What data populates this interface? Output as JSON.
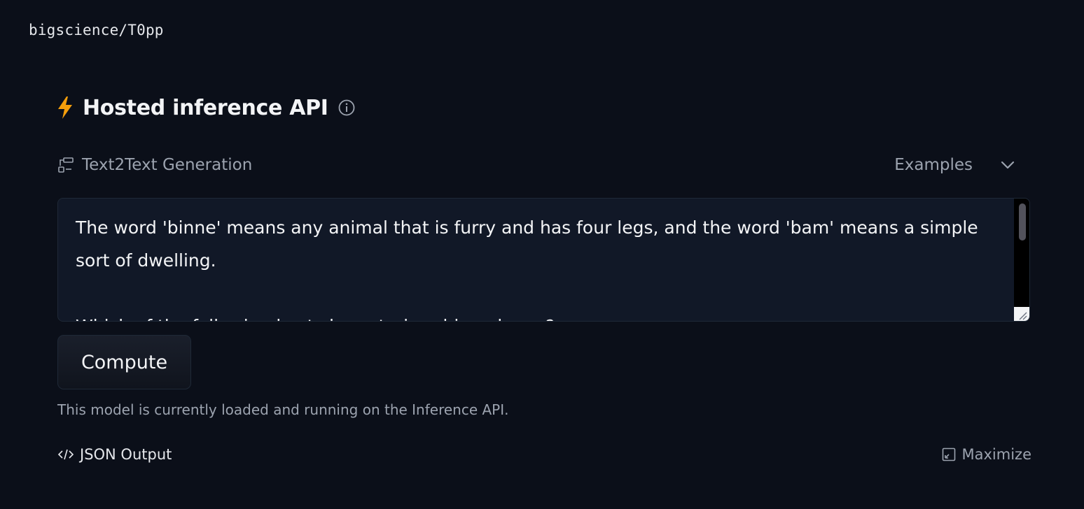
{
  "model_id": "bigscience/T0pp",
  "widget": {
    "title": "Hosted inference API",
    "task_label": "Text2Text Generation",
    "examples_label": "Examples",
    "input_text": "The word 'binne' means any animal that is furry and has four legs, and the word 'bam' means a simple sort of dwelling.\n\nWhich of the following best characterizes binne bams?",
    "compute_label": "Compute",
    "status_text": "This model is currently loaded and running on the Inference API.",
    "json_output_label": "JSON Output",
    "maximize_label": "Maximize"
  },
  "icons": {
    "bolt": "lightning-bolt-icon",
    "info": "info-icon",
    "task": "text2text-task-icon",
    "chevron": "chevron-down-icon",
    "code": "code-icon",
    "maximize": "maximize-icon"
  },
  "colors": {
    "background": "#0b0f19",
    "accent_bolt": "#f59e0b",
    "muted_text": "#9ca3af"
  }
}
